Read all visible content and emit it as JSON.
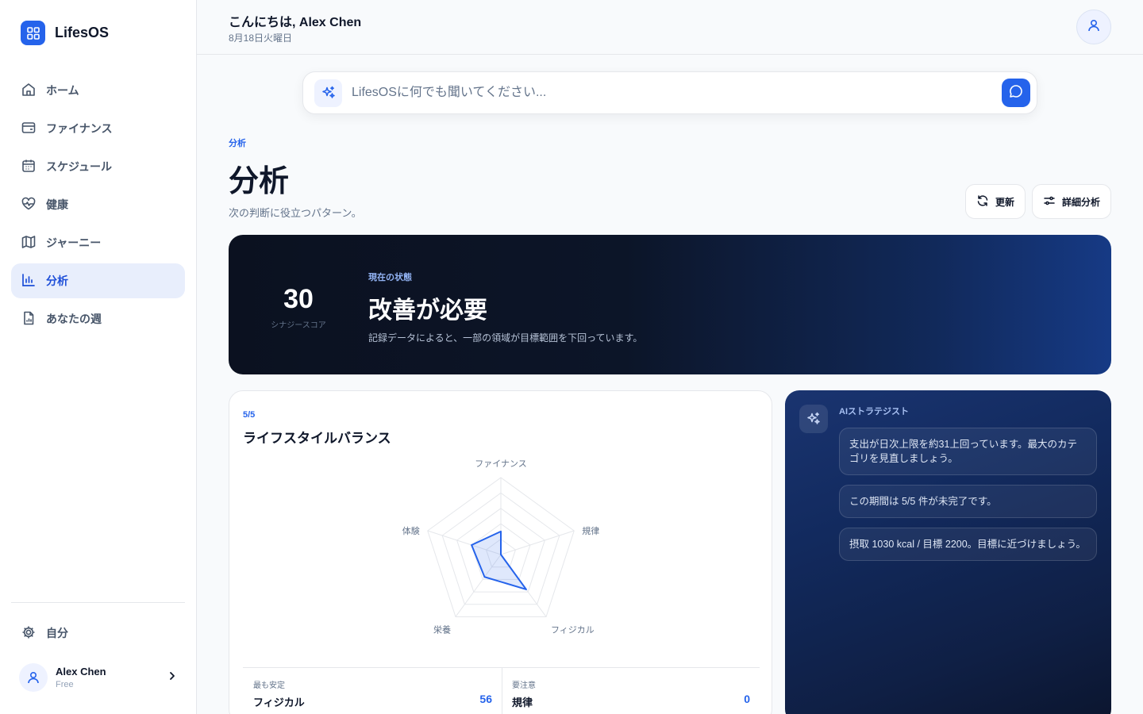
{
  "app": {
    "name": "LifesOS"
  },
  "sidebar": {
    "items": [
      {
        "label": "ホーム",
        "icon": "home-icon"
      },
      {
        "label": "ファイナンス",
        "icon": "wallet-icon"
      },
      {
        "label": "スケジュール",
        "icon": "calendar-icon"
      },
      {
        "label": "健康",
        "icon": "heart-pulse-icon"
      },
      {
        "label": "ジャーニー",
        "icon": "map-icon"
      },
      {
        "label": "分析",
        "icon": "bar-chart-icon",
        "active": true
      },
      {
        "label": "あなたの週",
        "icon": "file-chart-icon"
      }
    ],
    "settings_label": "自分",
    "user": {
      "name": "Alex Chen",
      "plan": "Free"
    }
  },
  "header": {
    "greeting": "こんにちは, Alex Chen",
    "date": "8月18日火曜日"
  },
  "search": {
    "placeholder": "LifesOSに何でも聞いてください..."
  },
  "page": {
    "eyebrow": "分析",
    "title": "分析",
    "subtitle": "次の判断に役立つパターン。",
    "refresh_label": "更新",
    "detail_label": "詳細分析"
  },
  "hero": {
    "score": "30",
    "score_label": "シナジースコア",
    "eyebrow": "現在の状態",
    "title": "改善が必要",
    "description": "記録データによると、一部の領域が目標範囲を下回っています。"
  },
  "balance": {
    "count": "5/5",
    "title": "ライフスタイルバランス",
    "most_stable_label": "最も安定",
    "most_stable_name": "フィジカル",
    "most_stable_value": "56",
    "attention_label": "要注意",
    "attention_name": "規律",
    "attention_value": "0"
  },
  "chart_data": {
    "type": "radar",
    "categories": [
      "ファイナンス",
      "規律",
      "フィジカル",
      "栄養",
      "体験"
    ],
    "values": [
      30,
      0,
      56,
      36,
      40
    ],
    "range": [
      0,
      100
    ]
  },
  "ai": {
    "title": "AIストラテジスト",
    "messages": [
      "支出が日次上限を約31上回っています。最大のカテゴリを見直しましょう。",
      "この期間は 5/5 件が未完了です。",
      "摂取 1030 kcal / 目標 2200。目標に近づけましょう。"
    ]
  },
  "colors": {
    "accent": "#2563eb",
    "hero_dark": "#0b1120",
    "hero_blue": "#163a85"
  }
}
